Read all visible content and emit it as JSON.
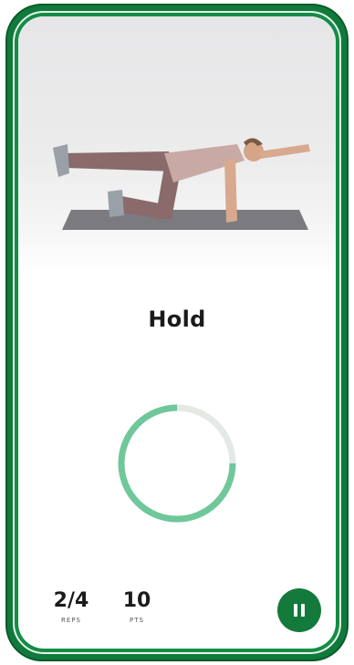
{
  "exercise": {
    "instruction": "Hold",
    "hold_progress_fraction": 0.75
  },
  "stats": {
    "reps_value": "2/4",
    "reps_label": "REPS",
    "points_value": "10",
    "points_label": "PTS"
  },
  "colors": {
    "frame_green": "#0f7a3a",
    "progress_green": "#6fc79a",
    "progress_track": "#e4e9e6",
    "button_green": "#137a3b"
  },
  "icons": {
    "pause": "pause-icon"
  }
}
